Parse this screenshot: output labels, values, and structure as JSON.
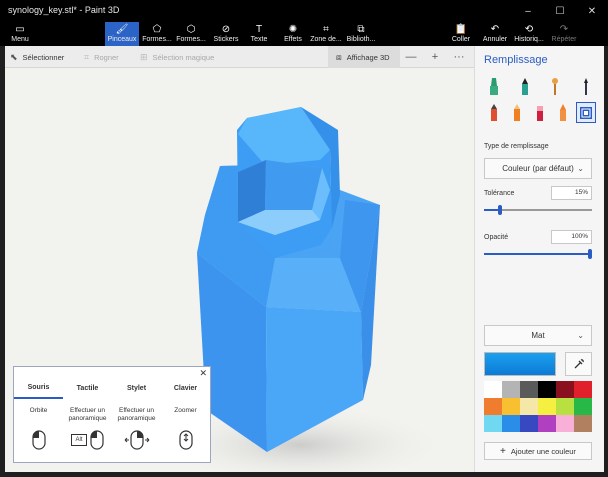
{
  "window": {
    "title": "synology_key.stl* - Paint 3D",
    "controls": {
      "minimize": "–",
      "maximize": "☐",
      "close": "✕"
    }
  },
  "ribbon": {
    "menu": "Menu",
    "tools": [
      {
        "id": "brushes",
        "label": "Pinceaux",
        "icon": "brush-icon",
        "glyph": "🖌",
        "active": true
      },
      {
        "id": "shapes2d",
        "label": "Formes...",
        "icon": "shapes-2d-icon",
        "glyph": "⬠"
      },
      {
        "id": "shapes3d",
        "label": "Formes...",
        "icon": "cube-icon",
        "glyph": "⬡"
      },
      {
        "id": "stickers",
        "label": "Stickers",
        "icon": "sticker-icon",
        "glyph": "⊘"
      },
      {
        "id": "text",
        "label": "Texte",
        "icon": "text-icon",
        "glyph": "T"
      },
      {
        "id": "effects",
        "label": "Effets",
        "icon": "effects-icon",
        "glyph": "✺"
      },
      {
        "id": "canvas",
        "label": "Zone de...",
        "icon": "canvas-icon",
        "glyph": "⌗"
      },
      {
        "id": "library",
        "label": "Biblioth...",
        "icon": "library-icon",
        "glyph": "⧉"
      }
    ],
    "right": [
      {
        "id": "paste",
        "label": "Coller",
        "icon": "paste-icon",
        "glyph": "📋"
      },
      {
        "id": "undo",
        "label": "Annuler",
        "icon": "undo-icon",
        "glyph": "↶"
      },
      {
        "id": "history",
        "label": "Historiq...",
        "icon": "history-icon",
        "glyph": "⟲"
      },
      {
        "id": "redo",
        "label": "Répéter",
        "icon": "redo-icon",
        "glyph": "↷",
        "disabled": true
      }
    ]
  },
  "toolbar": {
    "select": "Sélectionner",
    "crop": "Rogner",
    "magic_select": "Sélection magique",
    "view3d": "Affichage 3D",
    "zoom_out": "—",
    "zoom_in": "+",
    "more": "···"
  },
  "help": {
    "close": "✕",
    "tabs": [
      "Souris",
      "Tactile",
      "Stylet",
      "Clavier"
    ],
    "active_tab": "Souris",
    "gestures": [
      {
        "label": "Orbite",
        "icon": "mouse-left-icon"
      },
      {
        "label": "Effectuer un panoramique",
        "icon": "alt-mouse-icon",
        "key": "Alt"
      },
      {
        "label": "Effectuer un panoramique",
        "icon": "mouse-pan-icon"
      },
      {
        "label": "Zoomer",
        "icon": "mouse-wheel-icon"
      }
    ]
  },
  "panel": {
    "title": "Remplissage",
    "fill_type_label": "Type de remplissage",
    "fill_type_value": "Couleur (par défaut)",
    "tolerance_label": "Tolérance",
    "tolerance_value": "15%",
    "tolerance": 0.15,
    "opacity_label": "Opacité",
    "opacity_value": "100%",
    "opacity": 1.0,
    "finish_value": "Mat",
    "selected_color": "#1497e8",
    "add_color": "Ajouter une couleur",
    "palette": [
      "#ffffff",
      "#b4b4b4",
      "#5a5a5a",
      "#000000",
      "#8a1020",
      "#e0202a",
      "#f07c30",
      "#f8c030",
      "#f4e7a8",
      "#f4ef40",
      "#b8e040",
      "#28b848",
      "#70d8f0",
      "#2a8ee8",
      "#3848c0",
      "#b040c0",
      "#f8b0d8",
      "#b08060"
    ]
  }
}
